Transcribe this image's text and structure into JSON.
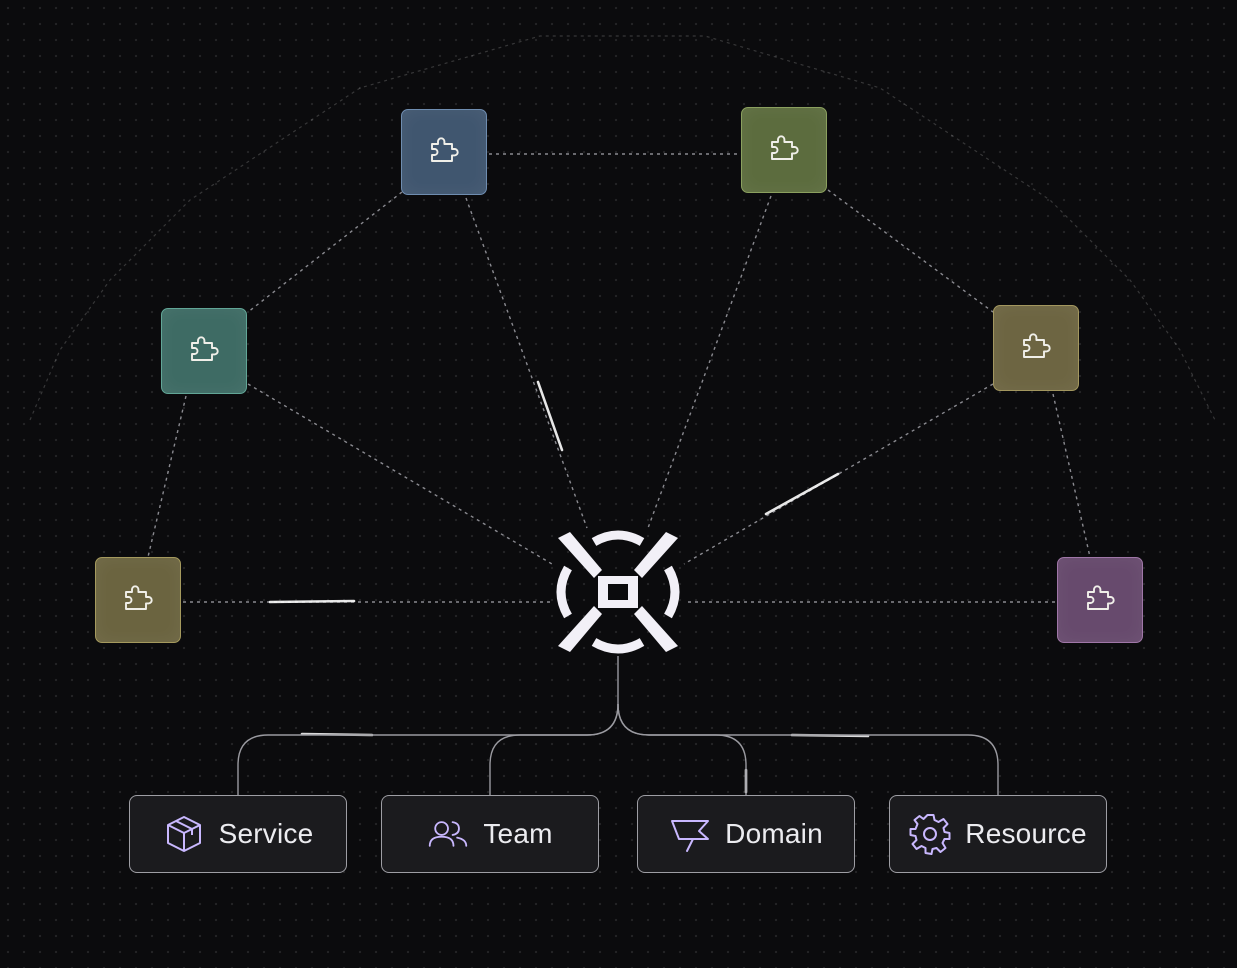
{
  "diagram": {
    "plugins": [
      {
        "id": "plugin-top-left",
        "icon": "puzzle-icon",
        "color": "#40566f",
        "border": "#6f8db0"
      },
      {
        "id": "plugin-top-right",
        "icon": "puzzle-icon",
        "color": "#5c6c3e",
        "border": "#8ba05f"
      },
      {
        "id": "plugin-mid-left",
        "icon": "puzzle-icon",
        "color": "#3e6b64",
        "border": "#62a697"
      },
      {
        "id": "plugin-mid-right",
        "icon": "puzzle-icon",
        "color": "#6d6542",
        "border": "#a3975f"
      },
      {
        "id": "plugin-low-left",
        "icon": "puzzle-icon",
        "color": "#6b6440",
        "border": "#a59a5e"
      },
      {
        "id": "plugin-low-right",
        "icon": "puzzle-icon",
        "color": "#674a6d",
        "border": "#a077a8"
      }
    ],
    "hub": {
      "icon": "hub-logo-icon",
      "color": "#f2f0f7"
    },
    "entities": [
      {
        "label": "Service",
        "icon": "package-icon"
      },
      {
        "label": "Team",
        "icon": "users-icon"
      },
      {
        "label": "Domain",
        "icon": "flag-icon"
      },
      {
        "label": "Resource",
        "icon": "gear-icon"
      }
    ],
    "colors": {
      "background": "#0b0b0d",
      "line": "#8a8a90",
      "icon_accent": "#c9b8ff"
    }
  }
}
